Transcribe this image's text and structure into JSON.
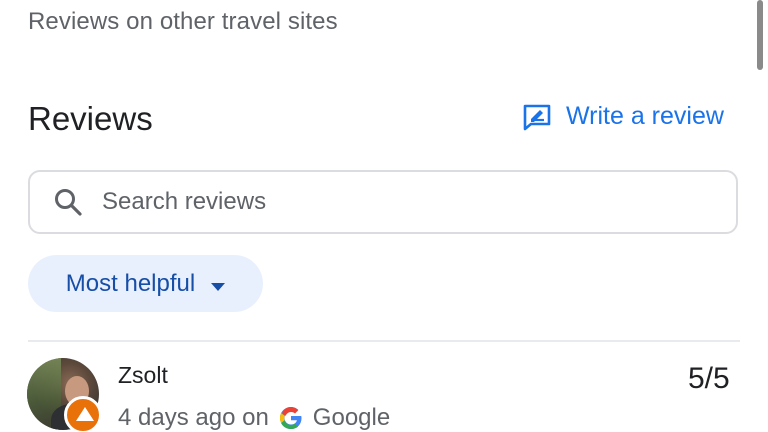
{
  "header": {
    "other_sites_label": "Reviews on other travel sites"
  },
  "reviews_section": {
    "title": "Reviews",
    "write_review_label": "Write a review"
  },
  "search": {
    "placeholder": "Search reviews",
    "value": ""
  },
  "sort": {
    "selected": "Most helpful"
  },
  "review": {
    "reviewer_name": "Zsolt",
    "time_ago": "4 days ago on",
    "source": "Google",
    "rating": "5/5"
  },
  "colors": {
    "accent": "#1a73e8",
    "chip_background": "#e8f0fe",
    "chip_text": "#174ea6",
    "text_primary": "#202124",
    "text_secondary": "#5f6368",
    "border": "#dadce0",
    "badge": "#e8710a"
  },
  "icons": {
    "write_review": "rate-review-icon",
    "search": "search-icon",
    "sort_dropdown": "arrow-drop-down-icon",
    "source": "google-g-icon",
    "badge": "local-guide-badge-icon"
  }
}
